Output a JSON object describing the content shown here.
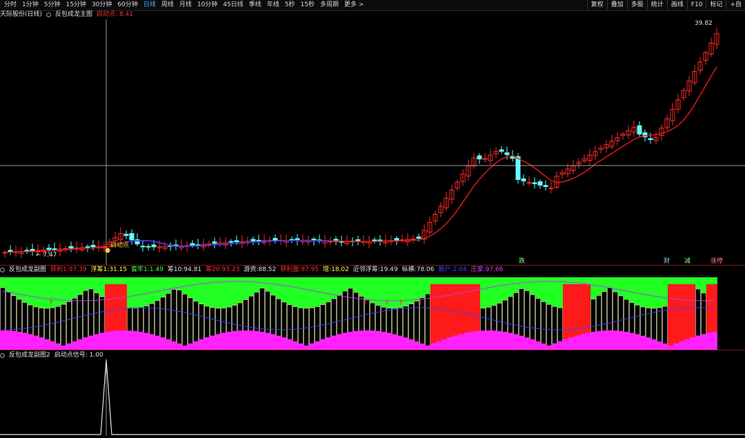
{
  "toolbar": {
    "periods": [
      {
        "label": "分时",
        "active": false
      },
      {
        "label": "1分钟",
        "active": false
      },
      {
        "label": "5分钟",
        "active": false
      },
      {
        "label": "15分钟",
        "active": false
      },
      {
        "label": "30分钟",
        "active": false
      },
      {
        "label": "60分钟",
        "active": false
      },
      {
        "label": "日线",
        "active": true
      },
      {
        "label": "周线",
        "active": false
      },
      {
        "label": "月线",
        "active": false
      },
      {
        "label": "10分钟",
        "active": false
      },
      {
        "label": "45日线",
        "active": false
      },
      {
        "label": "季线",
        "active": false
      },
      {
        "label": "年线",
        "active": false
      },
      {
        "label": "5秒",
        "active": false
      },
      {
        "label": "15秒",
        "active": false
      },
      {
        "label": "多周期",
        "active": false
      },
      {
        "label": "更多 >",
        "active": false
      }
    ],
    "right_buttons": [
      "复权",
      "叠加",
      "多股",
      "统计",
      "画线",
      "F10",
      "标记",
      "+自"
    ]
  },
  "main_header": {
    "stock_name": "天际股份(日线)",
    "indicator": "反包成龙主图",
    "signal_label": "启动点",
    "signal_value": "8.41"
  },
  "main_chart": {
    "price_high_label": "39.82",
    "price_low_label": "7.47",
    "start_marker": "启动点",
    "bottom_labels": [
      {
        "text": "跌",
        "color": "#7fff7f"
      },
      {
        "text": "财",
        "color": "#7fd0ff"
      },
      {
        "text": "减",
        "color": "#7fff7f"
      },
      {
        "text": "涨停",
        "color": "#ff7f7f"
      }
    ],
    "colors": {
      "up": "#ff2a2a",
      "down": "#66ffff",
      "ma_red": "#e01818",
      "ma_blue": "#3a3aff"
    }
  },
  "sub1_header": {
    "name": "反包成龙副图",
    "items": [
      {
        "label": "获利1:",
        "value": "97.39",
        "color": "#ff3030"
      },
      {
        "label": "浮筹1:",
        "value": "31.15",
        "color": "#ffff40"
      },
      {
        "label": "套牢1:",
        "value": "1.49",
        "color": "#40ff40"
      },
      {
        "label": "筹10:",
        "value": "94.81",
        "color": "#e0e0e0"
      },
      {
        "label": "筹20:",
        "value": "93.23",
        "color": "#ff3030"
      },
      {
        "label": "游资:",
        "value": "88.52",
        "color": "#e0e0e0"
      },
      {
        "label": "获利盘:",
        "value": "97.95",
        "color": "#ff3030"
      },
      {
        "label": "增:",
        "value": "18.02",
        "color": "#ffff40"
      },
      {
        "label": "近邻浮筹:",
        "value": "19.49",
        "color": "#e0e0e0"
      },
      {
        "label": "纵横:",
        "value": "78.06",
        "color": "#e0e0e0"
      },
      {
        "label": "散户:",
        "value": "2.04",
        "color": "#4040ff"
      },
      {
        "label": "庄家:",
        "value": "97.66",
        "color": "#e040ff"
      }
    ]
  },
  "sub2_header": {
    "name": "反包成龙副图2",
    "label": "启动点信号:",
    "value": "1.00"
  }
}
